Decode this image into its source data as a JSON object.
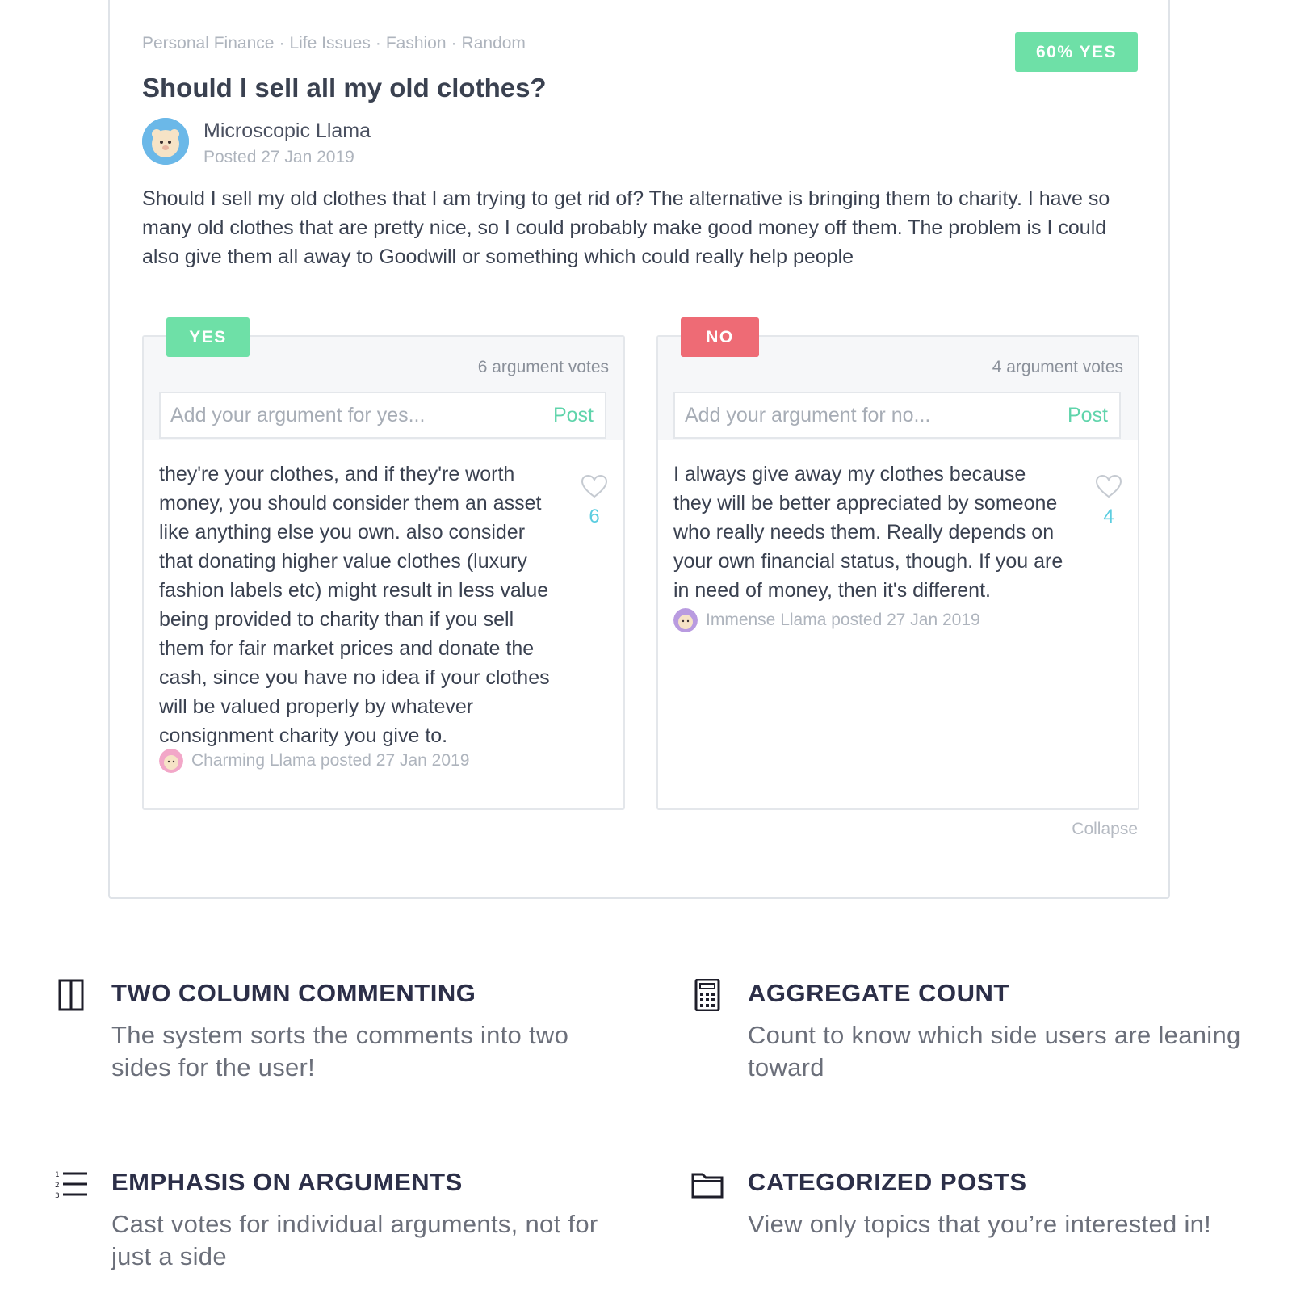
{
  "post": {
    "categories": [
      "Personal Finance",
      "Life Issues",
      "Fashion",
      "Random"
    ],
    "category_separator": "·",
    "result_badge": "60% YES",
    "title": "Should I sell all my old clothes?",
    "author": "Microscopic Llama",
    "posted": "Posted 27 Jan 2019",
    "body": "Should I sell my old clothes that I am trying to get rid of? The alternative is bringing them to charity. I have so many old clothes that are pretty nice, so I could probably make good money off them. The problem is I could also give them all away to Goodwill or something which could really help people",
    "collapse": "Collapse"
  },
  "yes": {
    "label": "YES",
    "votes": "6 argument votes",
    "placeholder": "Add your argument for yes...",
    "post": "Post",
    "argument": "they're your clothes, and if they're worth money, you should consider them an asset like anything else you own. also consider that donating higher value clothes (luxury fashion labels etc) might result in less value being provided to charity than if you sell them for fair market prices and donate the cash, since you have no idea if your clothes will be valued properly by whatever consignment charity you give to.",
    "likes": "6",
    "author_line": "Charming Llama posted 27 Jan 2019"
  },
  "no": {
    "label": "NO",
    "votes": "4 argument votes",
    "placeholder": "Add your argument for no...",
    "post": "Post",
    "argument": "I always give away my clothes because they will be better appreciated by someone who really needs them. Really depends on your own financial status, though. If you are in need of money, then it's different.",
    "likes": "4",
    "author_line": "Immense Llama posted 27 Jan 2019"
  },
  "features": [
    {
      "icon": "two-column-icon",
      "title": "TWO COLUMN COMMENTING",
      "desc": "The system sorts the comments into two sides for the user!"
    },
    {
      "icon": "calculator-icon",
      "title": "AGGREGATE COUNT",
      "desc": "Count to know which side users are leaning toward"
    },
    {
      "icon": "numbered-list-icon",
      "title": "EMPHASIS ON  ARGUMENTS",
      "desc": "Cast votes for individual arguments, not for just a side"
    },
    {
      "icon": "folder-icon",
      "title": "CATEGORIZED POSTS",
      "desc": "View only topics that you’re interested in!"
    }
  ],
  "colors": {
    "yes_accent": "#6ee0a7",
    "no_accent": "#ee6b75",
    "post_link": "#5fd4ab",
    "like_count": "#5ccde0"
  }
}
